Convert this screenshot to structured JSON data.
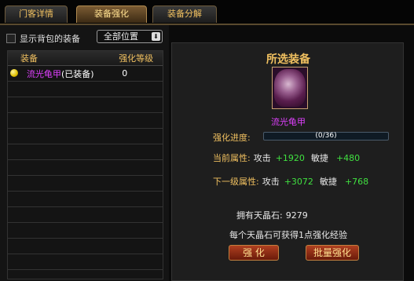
{
  "tabs": [
    {
      "label": "门客详情",
      "active": false
    },
    {
      "label": "装备强化",
      "active": true
    },
    {
      "label": "装备分解",
      "active": false
    }
  ],
  "left": {
    "show_bag_label": "显示背包的装备",
    "show_bag_checked": false,
    "position_select": "全部位置",
    "table": {
      "headers": {
        "name": "装备",
        "level": "强化等级"
      },
      "rows": [
        {
          "name": "流光龟甲",
          "suffix": "(已装备)",
          "level": "0"
        }
      ]
    }
  },
  "right": {
    "title": "所选装备",
    "item_name": "流光龟甲",
    "progress": {
      "label": "强化进度:",
      "text": "(0/36)",
      "fraction": 0.0
    },
    "current": {
      "label": "当前属性:",
      "k1": "攻击",
      "v1": "+1920",
      "k2": "敏捷",
      "v2": "+480"
    },
    "next": {
      "label": "下一级属性:",
      "k1": "攻击",
      "v1": "+3072",
      "k2": "敏捷",
      "v2": "+768"
    },
    "own_label": "拥有天晶石:",
    "own_value": "9279",
    "hint": "每个天晶石可获得1点强化经验",
    "buttons": {
      "enhance": "强 化",
      "batch": "批量强化"
    }
  },
  "colors": {
    "accent_gold": "#f0c060",
    "purple": "#e040ff",
    "green": "#40e040"
  }
}
